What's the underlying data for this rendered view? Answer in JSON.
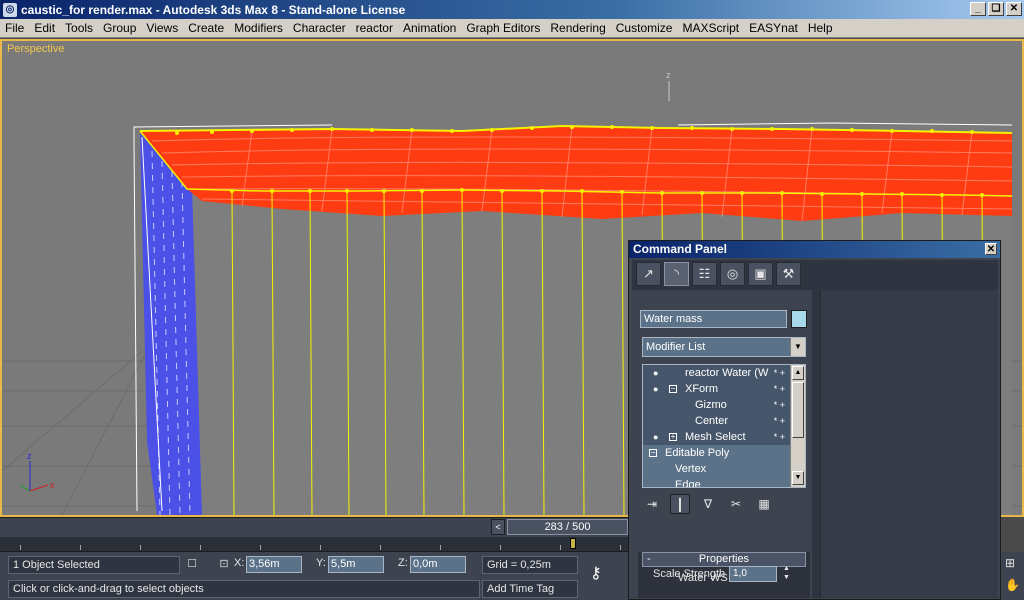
{
  "window": {
    "title": "caustic_for render.max - Autodesk 3ds Max 8  - Stand-alone License",
    "minimize": "_",
    "restore": "❏",
    "close": "✕"
  },
  "menu": {
    "items": [
      "File",
      "Edit",
      "Tools",
      "Group",
      "Views",
      "Create",
      "Modifiers",
      "Character",
      "reactor",
      "Animation",
      "Graph Editors",
      "Rendering",
      "Customize",
      "MAXScript",
      "EASYnat",
      "Help"
    ]
  },
  "viewport": {
    "label": "Perspective",
    "axis_z": "z",
    "gizmo_x": "x",
    "gizmo_z": "z",
    "colors": {
      "water_mesh": "#ff3b12",
      "wireframe": "#f5f200",
      "wall": "#4b50e6",
      "border": "#e8b84a"
    }
  },
  "command_panel": {
    "title": "Command Panel",
    "close": "✕",
    "tabs": [
      "↗",
      "◝",
      "☷",
      "◎",
      "▣",
      "⚒"
    ],
    "object_name": "Water mass",
    "object_color": "#a8d8ec",
    "modifier_list": "Modifier List",
    "dropdown_arrow": "▼",
    "stack": [
      {
        "label": "reactor Water (W",
        "stars": "* +",
        "bulb": true,
        "box": "",
        "indent": 0,
        "selected": true
      },
      {
        "label": "XForm",
        "stars": "* +",
        "bulb": true,
        "box": "−",
        "indent": 1,
        "selected": true
      },
      {
        "label": "Gizmo",
        "stars": "* +",
        "bulb": false,
        "box": "",
        "indent": 2,
        "selected": true
      },
      {
        "label": "Center",
        "stars": "* +",
        "bulb": false,
        "box": "",
        "indent": 2,
        "selected": true
      },
      {
        "label": "Mesh Select",
        "stars": "* +",
        "bulb": true,
        "box": "+",
        "indent": 1,
        "selected": false
      },
      {
        "label": "Editable Poly",
        "stars": "",
        "bulb": false,
        "box": "−",
        "indent": 0,
        "selected": false
      },
      {
        "label": "Vertex",
        "stars": "",
        "bulb": false,
        "box": "",
        "indent": 2,
        "selected": false
      },
      {
        "label": "Edge",
        "stars": "",
        "bulb": false,
        "box": "",
        "indent": 2,
        "selected": false
      }
    ],
    "stack_scroll_up": "▲",
    "stack_scroll_down": "▼",
    "stack_tools": [
      "⇥",
      "┃",
      "∇",
      "✂",
      "▦"
    ],
    "properties": {
      "header": "Properties",
      "collapse": "-",
      "subtitle": "Water WS Modifier",
      "scale_strength_label": "Scale Strength",
      "scale_strength_value": "1,0",
      "spin_up": "▲",
      "spin_down": "▼"
    }
  },
  "timeline": {
    "frame": "283 / 500",
    "prev": "<"
  },
  "status": {
    "selection": "1 Object Selected",
    "prompt": "Click or click-and-drag to select objects",
    "lock_icon": "☐",
    "x_label": "X:",
    "x_value": "3,56m",
    "y_label": "Y:",
    "y_value": "5,5m",
    "z_label": "Z:",
    "z_value": "0,0m",
    "grid": "Grid = 0,25m",
    "time_tag": "Add Time Tag",
    "key_icon": "⮜"
  },
  "right_bottom": [
    "⊞",
    "✋"
  ]
}
